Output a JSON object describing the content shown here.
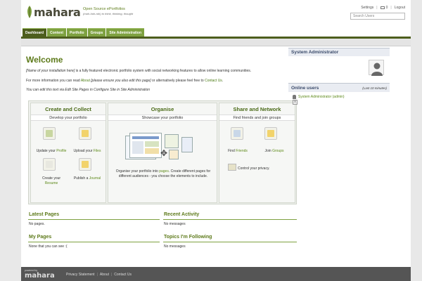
{
  "header": {
    "logo_text": "mahara",
    "tagline1": "Open Source ePortfolios",
    "tagline2": "(mah-hah-rah) to think, thinking, thought",
    "settings": "Settings",
    "mail_count": "0",
    "logout": "Logout",
    "search_placeholder": "Search Users"
  },
  "tabs": [
    {
      "label": "Dashboard",
      "active": true
    },
    {
      "label": "Content"
    },
    {
      "label": "Portfolio"
    },
    {
      "label": "Groups"
    },
    {
      "label": "Site Administration"
    }
  ],
  "main": {
    "title": "Welcome",
    "p1_em": "[Name of your installation here]",
    "p1_rest": " is a fully featured electronic portfolio system with social networking features to allow online learning communities.",
    "p2_a": "For more information you can read ",
    "p2_link1": "About",
    "p2_em": " [please ensure you also edit this page]",
    "p2_b": " or alternatively please feel free to ",
    "p2_link2": "Contact Us",
    "p2_c": ".",
    "p3": "You can edit this text via Edit Site Pages in Configure Site in Site Administration"
  },
  "panels": {
    "create": {
      "title": "Create and Collect",
      "sub": "Develop your portfolio",
      "update_a": "Update your ",
      "update_link": "Profile",
      "upload_a": "Upload your ",
      "upload_link": "Files",
      "create_a": "Create your",
      "create_link": "Resume",
      "publish_a": "Publish a ",
      "publish_link": "Journal"
    },
    "organise": {
      "title": "Organise",
      "sub": "Showcase your portfolio",
      "text_a": "Organise your portfolio into ",
      "text_link": "pages",
      "text_b": ". Create different pages for different audiences - you choose the elements to include."
    },
    "share": {
      "title": "Share and Network",
      "sub": "Find friends and join groups",
      "find_a": "Find ",
      "find_link": "Friends",
      "join_a": "Join ",
      "join_link": "Groups",
      "privacy": "Control your privacy."
    },
    "close": "x"
  },
  "sections": {
    "latest_pages": {
      "title": "Latest Pages",
      "text": "No pages."
    },
    "recent_activity": {
      "title": "Recent Activity",
      "text": "No messages"
    },
    "my_pages": {
      "title": "My Pages",
      "text": "None that you can see :("
    },
    "topics": {
      "title": "Topics I'm Following",
      "text": "No messages"
    }
  },
  "sidebar": {
    "user": "System Administrator",
    "online_title": "Online users",
    "online_period": "(Last 10 minutes)",
    "online_user": "System Administrator (admin)"
  },
  "footer": {
    "powered_by": "powered by",
    "logo": "mahara",
    "links": [
      "Privacy Statement",
      "About",
      "Contact Us"
    ]
  },
  "colors": {
    "brand_green": "#7ea140",
    "dark_green": "#4d5e1d",
    "title_green": "#5d7a1a"
  }
}
